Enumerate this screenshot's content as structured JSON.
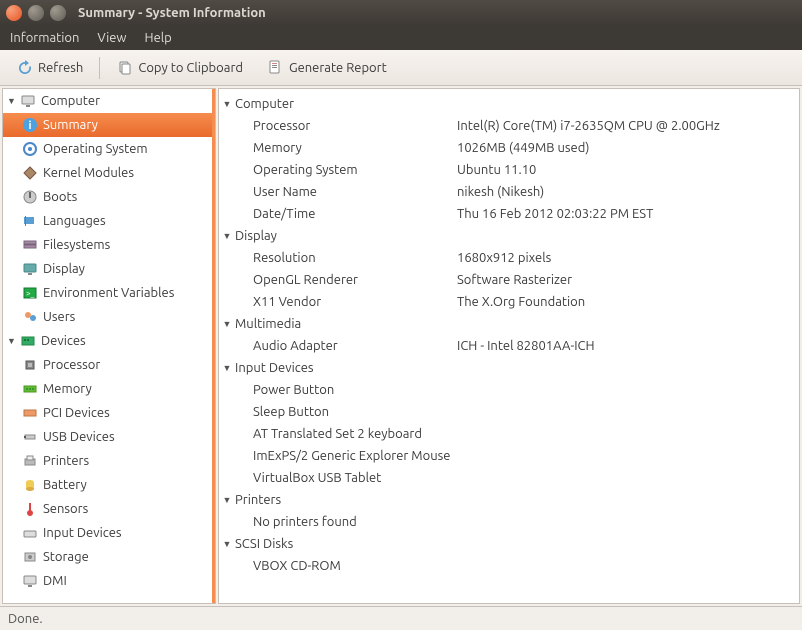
{
  "window": {
    "title": "Summary - System Information"
  },
  "menu": {
    "information": "Information",
    "view": "View",
    "help": "Help"
  },
  "toolbar": {
    "refresh": "Refresh",
    "copy": "Copy to Clipboard",
    "report": "Generate Report"
  },
  "sidebar": {
    "computer": {
      "label": "Computer",
      "items": [
        {
          "label": "Summary"
        },
        {
          "label": "Operating System"
        },
        {
          "label": "Kernel Modules"
        },
        {
          "label": "Boots"
        },
        {
          "label": "Languages"
        },
        {
          "label": "Filesystems"
        },
        {
          "label": "Display"
        },
        {
          "label": "Environment Variables"
        },
        {
          "label": "Users"
        }
      ]
    },
    "devices": {
      "label": "Devices",
      "items": [
        {
          "label": "Processor"
        },
        {
          "label": "Memory"
        },
        {
          "label": "PCI Devices"
        },
        {
          "label": "USB Devices"
        },
        {
          "label": "Printers"
        },
        {
          "label": "Battery"
        },
        {
          "label": "Sensors"
        },
        {
          "label": "Input Devices"
        },
        {
          "label": "Storage"
        },
        {
          "label": "DMI"
        }
      ]
    }
  },
  "content": [
    {
      "group": "Computer",
      "rows": [
        {
          "k": "Processor",
          "v": "Intel(R) Core(TM) i7-2635QM CPU @ 2.00GHz"
        },
        {
          "k": "Memory",
          "v": "1026MB (449MB used)"
        },
        {
          "k": "Operating System",
          "v": "Ubuntu 11.10"
        },
        {
          "k": "User Name",
          "v": "nikesh (Nikesh)"
        },
        {
          "k": "Date/Time",
          "v": "Thu 16 Feb 2012 02:03:22 PM EST"
        }
      ]
    },
    {
      "group": "Display",
      "rows": [
        {
          "k": "Resolution",
          "v": "1680x912 pixels"
        },
        {
          "k": "OpenGL Renderer",
          "v": "Software Rasterizer"
        },
        {
          "k": "X11 Vendor",
          "v": "The X.Org Foundation"
        }
      ]
    },
    {
      "group": "Multimedia",
      "rows": [
        {
          "k": "Audio Adapter",
          "v": "ICH - Intel 82801AA-ICH"
        }
      ]
    },
    {
      "group": "Input Devices",
      "rows": [
        {
          "k": "Power Button",
          "v": ""
        },
        {
          "k": "Sleep Button",
          "v": ""
        },
        {
          "k": "AT Translated Set 2 keyboard",
          "v": ""
        },
        {
          "k": "ImExPS/2 Generic Explorer Mouse",
          "v": ""
        },
        {
          "k": "VirtualBox USB Tablet",
          "v": ""
        }
      ]
    },
    {
      "group": "Printers",
      "rows": [
        {
          "k": "No printers found",
          "v": ""
        }
      ]
    },
    {
      "group": "SCSI Disks",
      "rows": [
        {
          "k": "VBOX CD-ROM",
          "v": ""
        }
      ]
    }
  ],
  "status": "Done."
}
